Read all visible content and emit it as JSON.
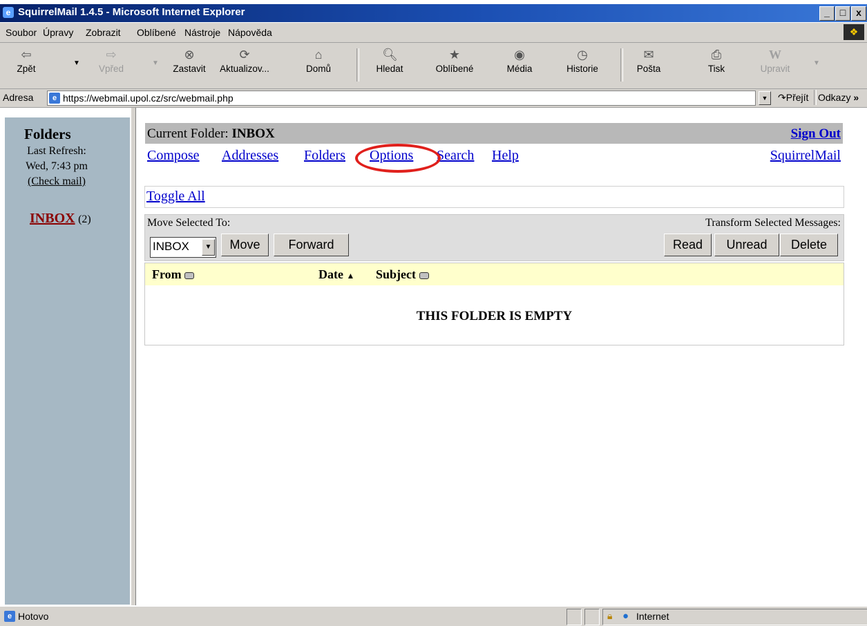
{
  "window": {
    "title": "SquirrelMail 1.4.5 - Microsoft Internet Explorer",
    "controls": [
      "_",
      "□",
      "x"
    ]
  },
  "menubar": [
    "Soubor",
    "Úpravy",
    "Zobrazit",
    "Oblíbené",
    "Nástroje",
    "Nápověda"
  ],
  "toolbar": {
    "back": "Zpět",
    "forward": "Vpřed",
    "stop": "Zastavit",
    "refresh": "Aktualizov...",
    "home": "Domů",
    "search": "Hledat",
    "favorites": "Oblíbené",
    "media": "Média",
    "history": "Historie",
    "mail": "Pošta",
    "print": "Tisk",
    "edit": "Upravit"
  },
  "address": {
    "label": "Adresa",
    "url": "https://webmail.upol.cz/src/webmail.php",
    "go": "Přejít",
    "links": "Odkazy"
  },
  "left": {
    "heading": "Folders",
    "refresh_label": "Last Refresh:",
    "refresh_time": "Wed, 7:43 pm",
    "check_mail": "(Check mail)",
    "folder_name": "INBOX",
    "folder_count": "(2)"
  },
  "main": {
    "current_folder_label": "Current Folder:",
    "current_folder": "INBOX",
    "sign_out": "Sign Out",
    "nav": [
      "Compose",
      "Addresses",
      "Folders",
      "Options",
      "Search",
      "Help"
    ],
    "brand": "SquirrelMail",
    "toggle_all": "Toggle All",
    "move_label": "Move Selected To:",
    "move_select": "INBOX",
    "move_btn": "Move",
    "forward_btn": "Forward",
    "transform_label": "Transform Selected Messages:",
    "read_btn": "Read",
    "unread_btn": "Unread",
    "delete_btn": "Delete",
    "columns": [
      "From",
      "Date",
      "Subject"
    ],
    "empty": "THIS FOLDER IS EMPTY"
  },
  "status": {
    "text": "Hotovo",
    "zone": "Internet"
  },
  "colors": {
    "highlight_circle": "#e0201c",
    "link": "#0000cc",
    "folder_link": "#8b0000"
  }
}
